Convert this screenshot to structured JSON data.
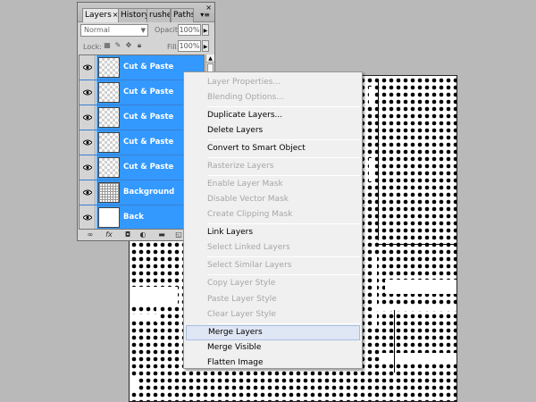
{
  "panel": {
    "tabs": [
      {
        "label": "Layers",
        "close": "×"
      },
      {
        "label": "History"
      },
      {
        "label": "rushes"
      },
      {
        "label": "Paths"
      }
    ],
    "close_glyph": "×",
    "menu_glyph": "▾≡",
    "blend_mode": "Normal",
    "opacity_label": "Opacity:",
    "opacity_value": "100%",
    "lock_label": "Lock:",
    "fill_label": "Fill:",
    "fill_value": "100%",
    "layers": [
      {
        "name": "Cut & Paste",
        "thumb": "checker"
      },
      {
        "name": "Cut & Paste",
        "thumb": "checker"
      },
      {
        "name": "Cut & Paste",
        "thumb": "checker"
      },
      {
        "name": "Cut & Paste",
        "thumb": "checker"
      },
      {
        "name": "Cut & Paste",
        "thumb": "checker"
      },
      {
        "name": "Background",
        "thumb": "grid"
      },
      {
        "name": "Back",
        "thumb": "white"
      }
    ],
    "bottom_icons": [
      "link-icon",
      "fx-icon",
      "mask-icon",
      "adjustment-icon",
      "folder-icon",
      "new-layer-icon",
      "trash-icon"
    ]
  },
  "context_menu": {
    "items": [
      {
        "label": "Layer Properties...",
        "enabled": false
      },
      {
        "label": "Blending Options...",
        "enabled": false
      },
      {
        "separator": true
      },
      {
        "label": "Duplicate Layers...",
        "enabled": true
      },
      {
        "label": "Delete Layers",
        "enabled": true
      },
      {
        "separator": true
      },
      {
        "label": "Convert to Smart Object",
        "enabled": true
      },
      {
        "separator": true
      },
      {
        "label": "Rasterize Layers",
        "enabled": false
      },
      {
        "separator": true
      },
      {
        "label": "Enable Layer Mask",
        "enabled": false
      },
      {
        "label": "Disable Vector Mask",
        "enabled": false
      },
      {
        "label": "Create Clipping Mask",
        "enabled": false
      },
      {
        "separator": true
      },
      {
        "label": "Link Layers",
        "enabled": true
      },
      {
        "label": "Select Linked Layers",
        "enabled": false
      },
      {
        "separator": true
      },
      {
        "label": "Select Similar Layers",
        "enabled": false
      },
      {
        "separator": true
      },
      {
        "label": "Copy Layer Style",
        "enabled": false
      },
      {
        "label": "Paste Layer Style",
        "enabled": false
      },
      {
        "label": "Clear Layer Style",
        "enabled": false
      },
      {
        "separator": true
      },
      {
        "label": "Merge Layers",
        "enabled": true,
        "highlighted": true
      },
      {
        "label": "Merge Visible",
        "enabled": true
      },
      {
        "label": "Flatten Image",
        "enabled": true
      }
    ]
  },
  "colors": {
    "selection": "#3399ff",
    "menu_bg": "#f0f0f0",
    "disabled_text": "#a6a6a6",
    "workspace": "#b9b9b9"
  }
}
